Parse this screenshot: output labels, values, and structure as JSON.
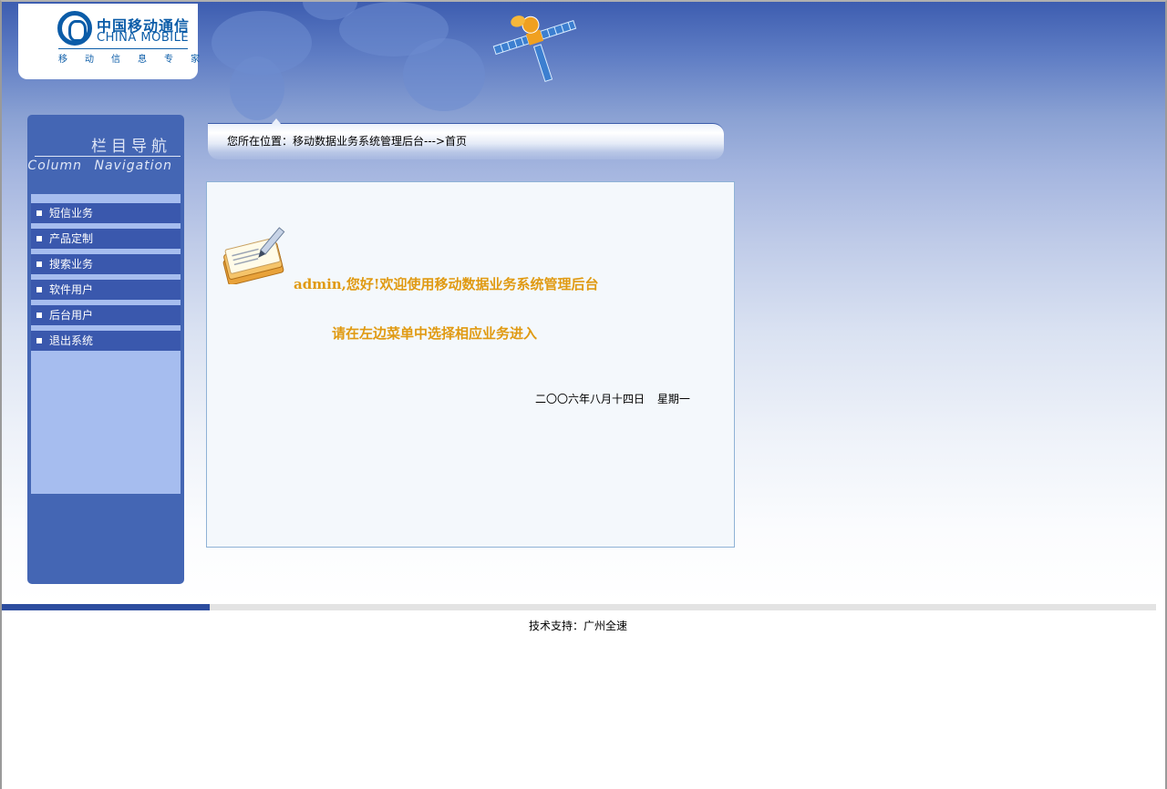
{
  "logo": {
    "cn": "中国移动通信",
    "en": "CHINA MOBILE",
    "slogan": "移动信息专家"
  },
  "sidebar": {
    "title_cn": "栏目导航",
    "title_en": "Column Navigation",
    "items": [
      {
        "label": "短信业务"
      },
      {
        "label": "产品定制"
      },
      {
        "label": "搜索业务"
      },
      {
        "label": "软件用户"
      },
      {
        "label": "后台用户"
      },
      {
        "label": "退出系统"
      }
    ]
  },
  "breadcrumb": {
    "text": "您所在位置：移动数据业务系统管理后台--->首页"
  },
  "main": {
    "welcome": "admin,您好!欢迎使用移动数据业务系统管理后台",
    "instruction": "请在左边菜单中选择相应业务进入",
    "date": "二〇〇六年八月十四日 星期一"
  },
  "footer": {
    "support": "技术支持：广州全速"
  },
  "colors": {
    "accent": "#e09a12",
    "nav_bg": "#4466b4",
    "menu_item": "#3a58ad",
    "brand": "#0b5ca8"
  },
  "icons": [
    "china-mobile-logo-icon",
    "satellite-icon",
    "notepad-pencil-icon",
    "bullet-icon"
  ]
}
